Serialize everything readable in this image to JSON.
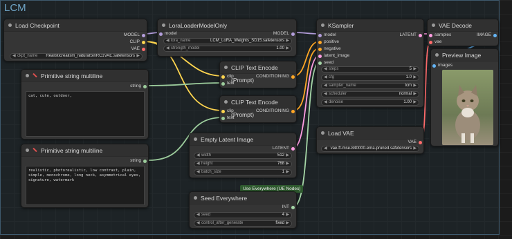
{
  "group": {
    "title": "LCM"
  },
  "colors": {
    "model": "#b39ddb",
    "clip": "#ffd54f",
    "vae": "#ff6b6b",
    "conditioning": "#ffa726",
    "latent": "#ff9de2",
    "image": "#64b5f6",
    "string": "#9ccc9c",
    "int": "#a5d6a7"
  },
  "load_checkpoint": {
    "title": "Load Checkpoint",
    "out_model": "MODEL",
    "out_clip": "CLIP",
    "out_vae": "VAE",
    "ckpt_label": "ckpt_name",
    "ckpt_value": "Realisticrealism_naturalSinRC1VAE.safetensors"
  },
  "lora": {
    "title": "LoraLoaderModelOnly",
    "in_model": "model",
    "out_model": "MODEL",
    "lora_label": "lora_name",
    "lora_value": "LCM_LoRA_Weights_SD15.safetensors",
    "strength_label": "strength_model",
    "strength_value": "1.00"
  },
  "ksampler": {
    "title": "KSampler",
    "in_model": "model",
    "in_positive": "positive",
    "in_negative": "negative",
    "in_latent": "latent_image",
    "in_seed": "seed",
    "out_latent": "LATENT",
    "steps_label": "steps",
    "steps_value": "5",
    "cfg_label": "cfg",
    "cfg_value": "1.0",
    "sampler_label": "sampler_name",
    "sampler_value": "lcm",
    "scheduler_label": "scheduler",
    "scheduler_value": "normal",
    "denoise_label": "denoise",
    "denoise_value": "1.00"
  },
  "vae_decode": {
    "title": "VAE Decode",
    "in_samples": "samples",
    "in_vae": "vae",
    "out_image": "IMAGE"
  },
  "preview": {
    "title": "Preview Image",
    "in_images": "images"
  },
  "clip_pos": {
    "title": "CLIP Text Encode (Prompt)",
    "in_clip": "clip",
    "in_text": "text",
    "out": "CONDITIONING"
  },
  "clip_neg": {
    "title": "CLIP Text Encode (Prompt)",
    "in_clip": "clip",
    "in_text": "text",
    "out": "CONDITIONING"
  },
  "prim_pos": {
    "title": "Primitive string multiline",
    "out": "string",
    "text": "cat, cute, outdoor,"
  },
  "prim_neg": {
    "title": "Primitive string multiline",
    "out": "string",
    "text": "realistic, photorealistic, low contrast, plain, simple, monochrome, long neck, asymmetrical eyes, signature, watermark"
  },
  "empty_latent": {
    "title": "Empty Latent Image",
    "out": "LATENT",
    "width_label": "width",
    "width_value": "512",
    "height_label": "height",
    "height_value": "768",
    "batch_label": "batch_size",
    "batch_value": "1"
  },
  "load_vae": {
    "title": "Load VAE",
    "out": "VAE",
    "vae_value": "vae-ft-mse-840000-ema-pruned.safetensors"
  },
  "use_everywhere": {
    "label": "Use Everywhere (UE Nodes)"
  },
  "seed": {
    "title": "Seed Everywhere",
    "out": "INT",
    "seed_label": "seed",
    "seed_value": "4",
    "control_label": "control_after_generate",
    "control_value": "fixed"
  }
}
